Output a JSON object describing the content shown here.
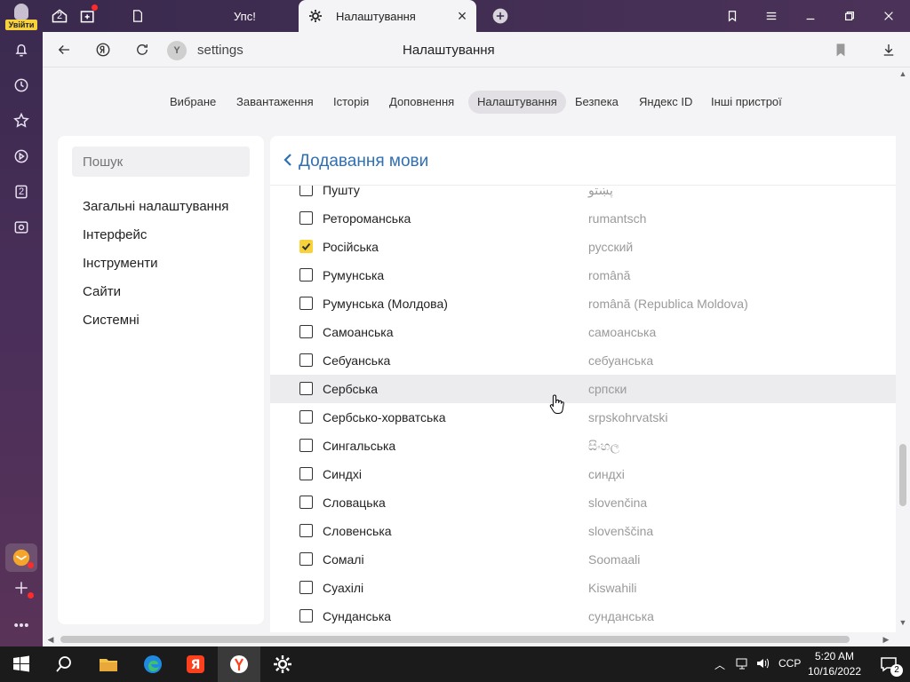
{
  "rail": {
    "login_label": "Увійти",
    "tab_count_badge": "2"
  },
  "tabbar": {
    "tab_counter": "2",
    "tabs": [
      {
        "title": "Упс!"
      },
      {
        "title": "Налаштування"
      }
    ]
  },
  "addressbar": {
    "url": "settings",
    "page_title": "Налаштування"
  },
  "nav": {
    "items": [
      {
        "label": "Вибране"
      },
      {
        "label": "Завантаження"
      },
      {
        "label": "Історія"
      },
      {
        "label": "Доповнення"
      },
      {
        "label": "Налаштування"
      },
      {
        "label": "Безпека"
      },
      {
        "label": "Яндекс ID"
      },
      {
        "label": "Інші пристрої"
      }
    ],
    "active_index": 4
  },
  "sidebar": {
    "search_placeholder": "Пошук",
    "links": [
      {
        "label": "Загальні налаштування"
      },
      {
        "label": "Інтерфейс"
      },
      {
        "label": "Інструменти"
      },
      {
        "label": "Сайти"
      },
      {
        "label": "Системні"
      }
    ]
  },
  "panel": {
    "title": "Додавання мови",
    "languages": [
      {
        "name": "Пушту",
        "native": "پښتو",
        "checked": false
      },
      {
        "name": "Ретороманська",
        "native": "rumantsch",
        "checked": false
      },
      {
        "name": "Російська",
        "native": "русский",
        "checked": true
      },
      {
        "name": "Румунська",
        "native": "română",
        "checked": false
      },
      {
        "name": "Румунська (Молдова)",
        "native": "română (Republica Moldova)",
        "checked": false
      },
      {
        "name": "Самоанська",
        "native": "самоанська",
        "checked": false
      },
      {
        "name": "Себуанська",
        "native": "себуанська",
        "checked": false
      },
      {
        "name": "Сербська",
        "native": "српски",
        "checked": false
      },
      {
        "name": "Сербсько-хорватська",
        "native": "srpskohrvatski",
        "checked": false
      },
      {
        "name": "Сингальська",
        "native": "සිංහල",
        "checked": false
      },
      {
        "name": "Синдхі",
        "native": "синдхі",
        "checked": false
      },
      {
        "name": "Словацька",
        "native": "slovenčina",
        "checked": false
      },
      {
        "name": "Словенська",
        "native": "slovenščina",
        "checked": false
      },
      {
        "name": "Сомалі",
        "native": "Soomaali",
        "checked": false
      },
      {
        "name": "Суахілі",
        "native": "Kiswahili",
        "checked": false
      },
      {
        "name": "Сунданська",
        "native": "сунданська",
        "checked": false
      }
    ],
    "hovered_index": 7
  },
  "taskbar": {
    "language": "CCP",
    "time": "5:20 AM",
    "date": "10/16/2022",
    "notifications": "2"
  },
  "colors": {
    "accent_blue": "#2f6fb3",
    "yandex_yellow": "#f8d23a",
    "rail_purple": "#3a2a4e"
  }
}
